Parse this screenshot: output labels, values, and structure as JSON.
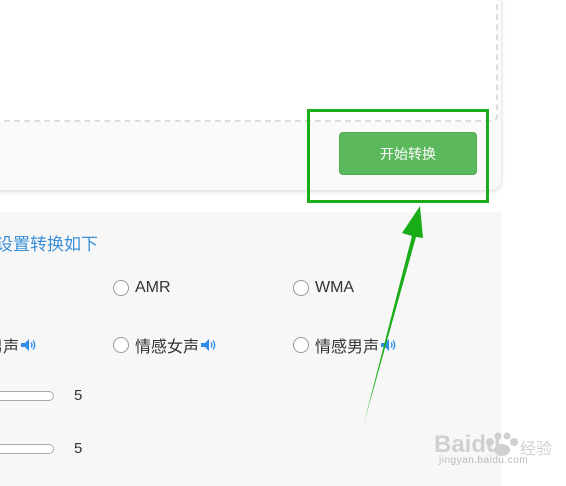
{
  "upload": {
    "convert_button_label": "开始转换"
  },
  "settings": {
    "title": "设置转换如下",
    "formats": [
      {
        "label": "AMR",
        "selected": false
      },
      {
        "label": "WMA",
        "selected": false
      }
    ],
    "voices": [
      {
        "label": "男声",
        "selected": false
      },
      {
        "label": "情感女声",
        "selected": false
      },
      {
        "label": "情感男声",
        "selected": false
      }
    ],
    "sliders": [
      {
        "value": "5"
      },
      {
        "value": "5"
      }
    ]
  },
  "annotation": {
    "color": "#1aad19"
  },
  "watermark": {
    "brand": "Baidu",
    "brand_suffix": "经验",
    "site": "jingyan.baidu.com"
  },
  "colors": {
    "button_green": "#5cb85c",
    "title_blue": "#3a8fd8",
    "speaker_blue": "#2f8fe6"
  }
}
